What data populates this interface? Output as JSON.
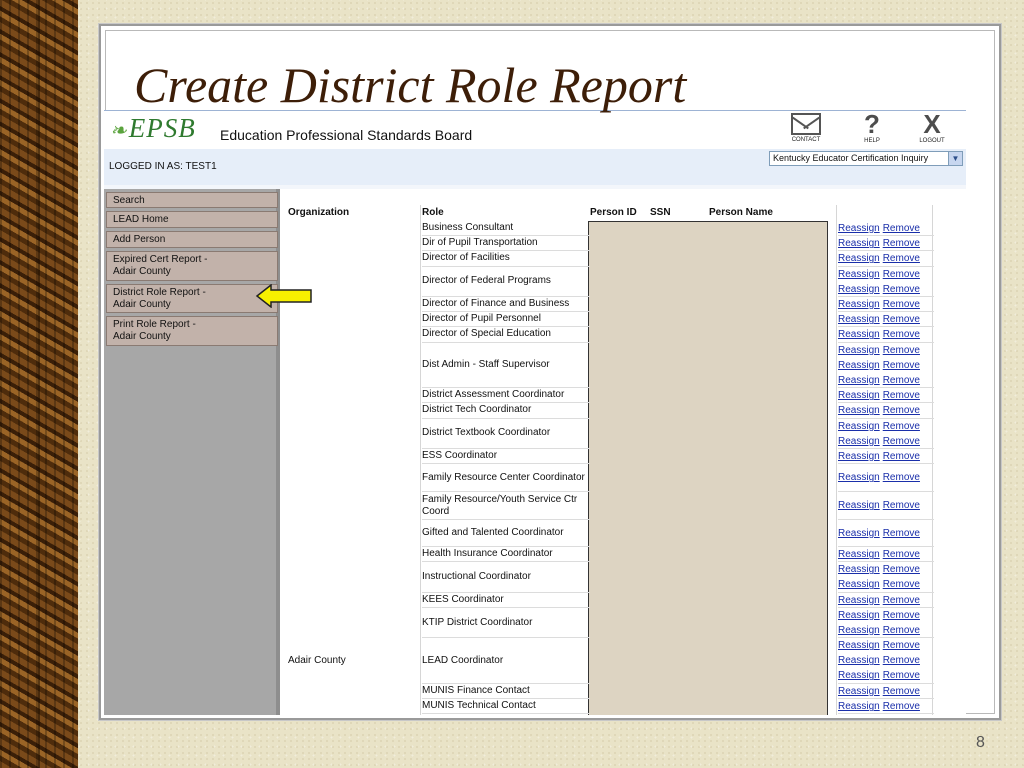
{
  "slide": {
    "title": "Create District Role Report",
    "page_number": "8"
  },
  "header": {
    "logo": "EPSB",
    "org_name": "Education Professional Standards Board",
    "icons": [
      {
        "name": "contact",
        "label": "CONTACT"
      },
      {
        "name": "help",
        "label": "HELP"
      },
      {
        "name": "logout",
        "label": "LOGOUT"
      }
    ],
    "logged_in": "LOGGED IN AS: TEST1",
    "app_select": "Kentucky Educator Certification Inquiry"
  },
  "sidebar": {
    "items": [
      {
        "label": "Search"
      },
      {
        "label": "LEAD Home"
      },
      {
        "label": "Add Person"
      },
      {
        "label": "Expired Cert Report - Adair County"
      },
      {
        "label": "District Role Report - Adair County"
      },
      {
        "label": "Print Role Report - Adair County"
      }
    ]
  },
  "table": {
    "columns": [
      "Organization",
      "Role",
      "Person ID",
      "SSN",
      "Person Name"
    ],
    "organization": "Adair County",
    "action_labels": {
      "reassign": "Reassign",
      "remove": "Remove"
    },
    "rows": [
      {
        "role": "Business Consultant",
        "slots": 1
      },
      {
        "role": "Dir of Pupil Transportation",
        "slots": 1
      },
      {
        "role": "Director of Facilities",
        "slots": 1
      },
      {
        "role": "Director of Federal Programs",
        "slots": 2
      },
      {
        "role": "Director of Finance and Business",
        "slots": 1
      },
      {
        "role": "Director of Pupil Personnel",
        "slots": 1
      },
      {
        "role": "Director of Special Education",
        "slots": 1
      },
      {
        "role": "Dist Admin - Staff Supervisor",
        "slots": 3
      },
      {
        "role": "District Assessment Coordinator",
        "slots": 1
      },
      {
        "role": "District Tech Coordinator",
        "slots": 1
      },
      {
        "role": "District Textbook Coordinator",
        "slots": 2
      },
      {
        "role": "ESS Coordinator",
        "slots": 1
      },
      {
        "role": "Family Resource Center Coordinator",
        "slots": 1
      },
      {
        "role": "Family Resource/Youth Service Ctr Coord",
        "slots": 1
      },
      {
        "role": "Gifted and Talented Coordinator",
        "slots": 1
      },
      {
        "role": "Health Insurance Coordinator",
        "slots": 1
      },
      {
        "role": "Instructional Coordinator",
        "slots": 2
      },
      {
        "role": "KEES Coordinator",
        "slots": 1
      },
      {
        "role": "KTIP District Coordinator",
        "slots": 2
      },
      {
        "role": "LEAD Coordinator",
        "slots": 3
      },
      {
        "role": "MUNIS Finance Contact",
        "slots": 1
      },
      {
        "role": "MUNIS Technical Contact",
        "slots": 1
      }
    ]
  }
}
